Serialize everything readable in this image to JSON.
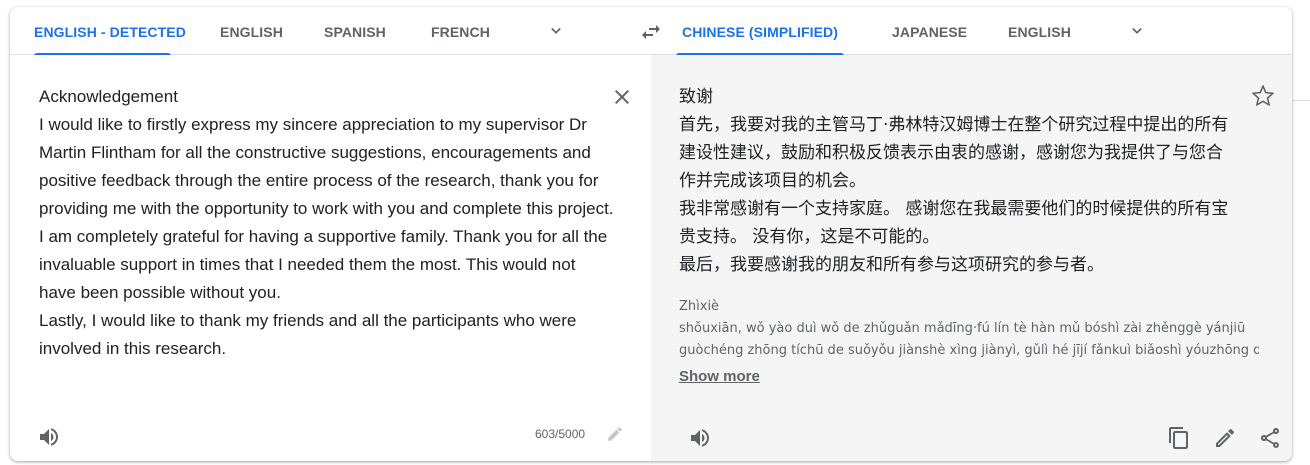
{
  "source_tabs": [
    {
      "label": "English - detected",
      "active": true
    },
    {
      "label": "English",
      "active": false
    },
    {
      "label": "Spanish",
      "active": false
    },
    {
      "label": "French",
      "active": false
    }
  ],
  "target_tabs": [
    {
      "label": "Chinese (Simplified)",
      "active": true
    },
    {
      "label": "Japanese",
      "active": false
    },
    {
      "label": "English",
      "active": false
    }
  ],
  "source": {
    "text": "Acknowledgement\nI would like to firstly express my sincere appreciation to my supervisor Dr Martin Flintham for all the constructive suggestions, encouragements and positive feedback through the entire process of the research, thank you for providing me with the opportunity to work with you and complete this project.\nI am completely grateful for having a supportive family. Thank you for all the invaluable support in times that I needed them the most. This would not have been possible without you.\nLastly, I would like to thank my friends and all the participants who were involved in this research.",
    "char_count": "603/5000"
  },
  "target": {
    "text": "致谢\n首先，我要对我的主管马丁·弗林特汉姆博士在整个研究过程中提出的所有建设性建议，鼓励和积极反馈表示由衷的感谢，感谢您为我提供了与您合作并完成该项目的机会。\n我非常感谢有一个支持家庭。 感谢您在我最需要他们的时候提供的所有宝贵支持。 没有你，这是不可能的。\n最后，我要感谢我的朋友和所有参与这项研究的参与者。",
    "translit": [
      "Zhìxiè",
      "shǒuxiān, wǒ yào duì wǒ de zhǔguǎn mǎdīng·fú lín tè hàn mǔ bóshì zài zhěnggè yánjiū",
      "guòchéng zhōng tíchū de suǒyǒu jiànshè xìng jiànyì, gǔlì hé jījí fǎnkuì biǎoshì yóuzhōng de"
    ],
    "show_more": "Show more"
  },
  "colors": {
    "accent": "#1a73e8",
    "muted": "#5f6368",
    "target_bg": "#f5f5f5"
  },
  "icons": [
    "chevron-down-icon",
    "swap-languages-icon",
    "close-icon",
    "speaker-icon",
    "pencil-icon",
    "star-icon",
    "copy-icon",
    "share-icon"
  ]
}
